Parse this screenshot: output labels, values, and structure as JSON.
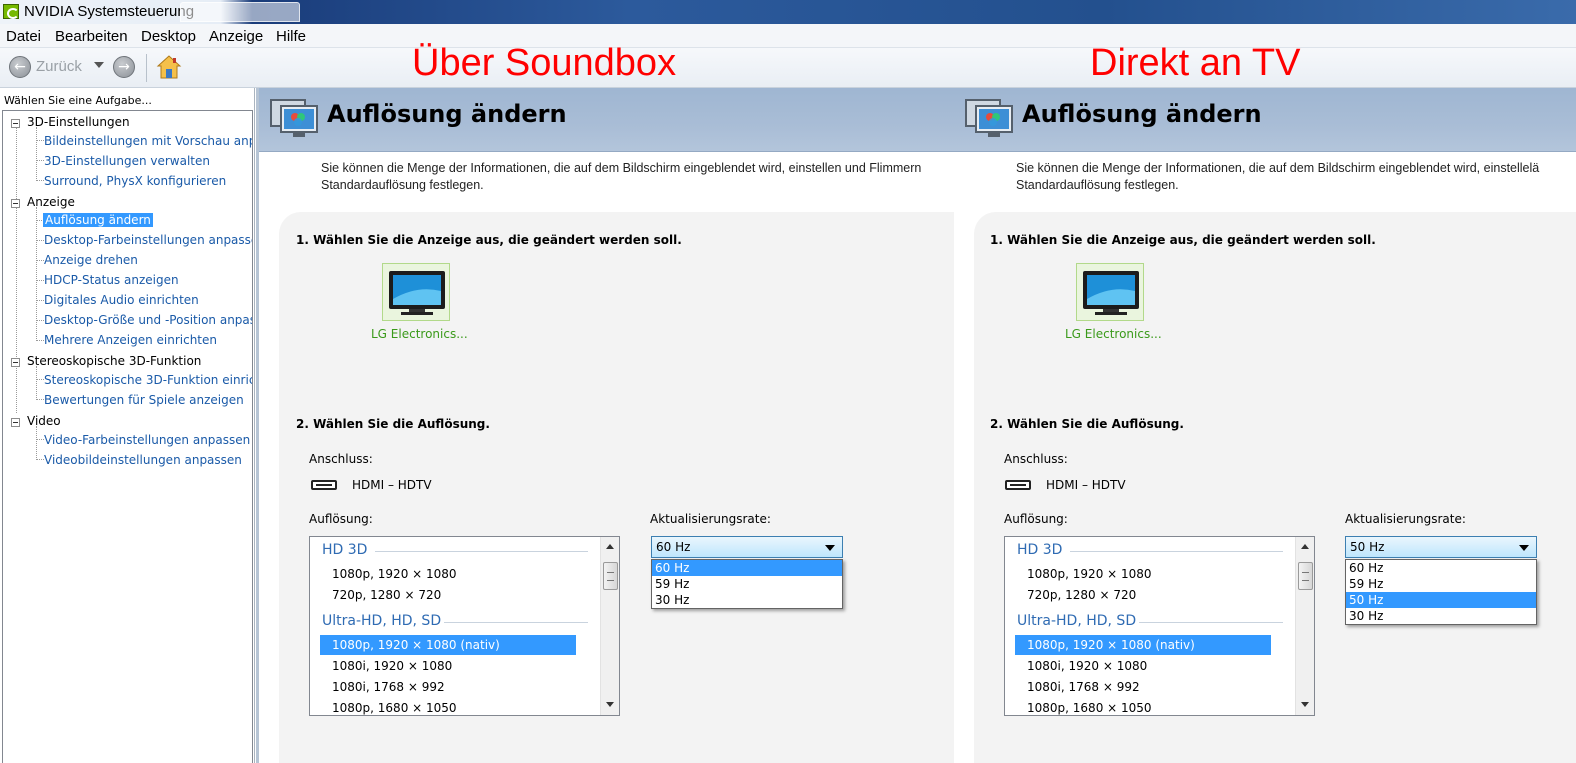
{
  "window": {
    "title": "NVIDIA Systemsteuerung"
  },
  "menu": [
    "Datei",
    "Bearbeiten",
    "Desktop",
    "Anzeige",
    "Hilfe"
  ],
  "toolbar": {
    "back_label": "Zurück"
  },
  "annotations": {
    "left": "Über Soundbox",
    "right": "Direkt an TV"
  },
  "sidebar": {
    "header": "Wählen Sie eine Aufgabe...",
    "categories": [
      {
        "label": "3D-Einstellungen",
        "items": [
          "Bildeinstellungen mit Vorschau anpa",
          "3D-Einstellungen verwalten",
          "Surround, PhysX konfigurieren"
        ]
      },
      {
        "label": "Anzeige",
        "items": [
          "Auflösung ändern",
          "Desktop-Farbeinstellungen anpasser",
          "Anzeige drehen",
          "HDCP-Status anzeigen",
          "Digitales Audio einrichten",
          "Desktop-Größe und -Position anpass",
          "Mehrere Anzeigen einrichten"
        ]
      },
      {
        "label": "Stereoskopische 3D-Funktion",
        "items": [
          "Stereoskopische 3D-Funktion einrich",
          "Bewertungen für Spiele anzeigen"
        ]
      },
      {
        "label": "Video",
        "items": [
          "Video-Farbeinstellungen anpassen",
          "Videobildeinstellungen anpassen"
        ]
      }
    ],
    "selected_item": "Auflösung ändern"
  },
  "panels": [
    {
      "title": "Auflösung ändern",
      "description_line1": "Sie können die Menge der Informationen, die auf dem Bildschirm eingeblendet wird, einstellen und Flimmern",
      "description_line2": "Standardauflösung festlegen.",
      "step1": "1. Wählen Sie die Anzeige aus, die geändert werden soll.",
      "display_name": "LG Electronics...",
      "step2": "2. Wählen Sie die Auflösung.",
      "connection_label": "Anschluss:",
      "connection_value": "HDMI – HDTV",
      "resolution_label": "Auflösung:",
      "refresh_label": "Aktualisierungsrate:",
      "groups": [
        "HD 3D",
        "Ultra-HD, HD, SD"
      ],
      "group1_items": [
        "1080p, 1920 × 1080",
        "720p, 1280 × 720"
      ],
      "group2_items": [
        "1080p, 1920 × 1080 (nativ)",
        "1080i, 1920 × 1080",
        "1080i, 1768 × 992",
        "1080p, 1680 × 1050"
      ],
      "selected_resolution": "1080p, 1920 × 1080 (nativ)",
      "refresh_value": "60 Hz",
      "refresh_options": [
        "60 Hz",
        "59 Hz",
        "30 Hz"
      ],
      "refresh_selected": "60 Hz"
    },
    {
      "title": "Auflösung ändern",
      "description_line1": "Sie können die Menge der Informationen, die auf dem Bildschirm eingeblendet wird, einstellelä",
      "description_line2": "Standardauflösung festlegen.",
      "step1": "1. Wählen Sie die Anzeige aus, die geändert werden soll.",
      "display_name": "LG Electronics...",
      "step2": "2. Wählen Sie die Auflösung.",
      "connection_label": "Anschluss:",
      "connection_value": "HDMI – HDTV",
      "resolution_label": "Auflösung:",
      "refresh_label": "Aktualisierungsrate:",
      "groups": [
        "HD 3D",
        "Ultra-HD, HD, SD"
      ],
      "group1_items": [
        "1080p, 1920 × 1080",
        "720p, 1280 × 720"
      ],
      "group2_items": [
        "1080p, 1920 × 1080 (nativ)",
        "1080i, 1920 × 1080",
        "1080i, 1768 × 992",
        "1080p, 1680 × 1050"
      ],
      "selected_resolution": "1080p, 1920 × 1080 (nativ)",
      "refresh_value": "50 Hz",
      "refresh_options": [
        "60 Hz",
        "59 Hz",
        "50 Hz",
        "30 Hz"
      ],
      "refresh_selected": "50 Hz"
    }
  ],
  "colors": {
    "annotation": "#ff0000",
    "selection": "#3399ff",
    "link": "#1a5aa8",
    "display_name": "#3a9a1a",
    "banner": "#a9bdd6"
  }
}
